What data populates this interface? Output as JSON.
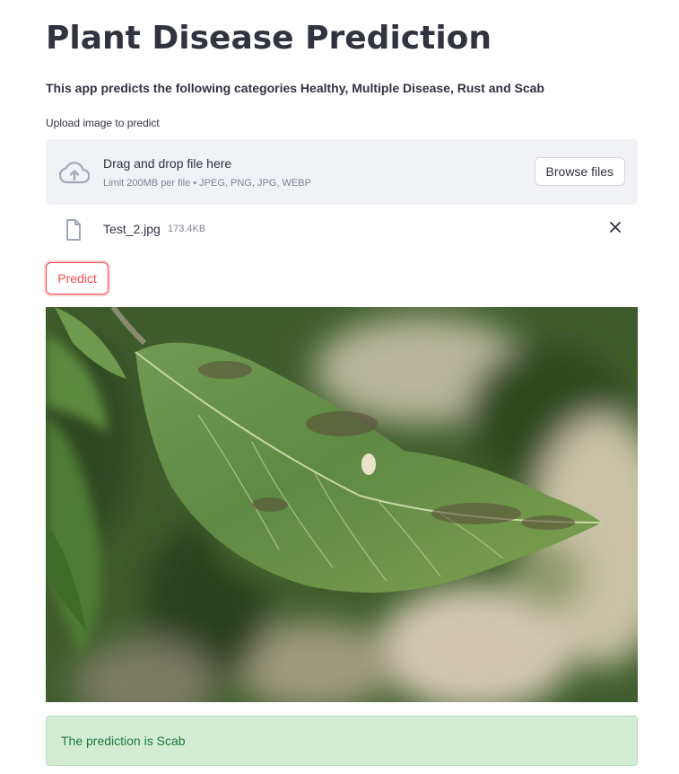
{
  "app": {
    "title": "Plant Disease Prediction",
    "subtitle": "This app predicts the following categories Healthy, Multiple Disease, Rust and Scab"
  },
  "uploader": {
    "label": "Upload image to predict",
    "dropzone_title": "Drag and drop file here",
    "dropzone_limit": "Limit 200MB per file • JPEG, PNG, JPG, WEBP",
    "browse_label": "Browse files",
    "cloud_icon": "cloud-upload-icon"
  },
  "uploaded_file": {
    "name": "Test_2.jpg",
    "size": "173.4KB",
    "file_icon": "file-icon",
    "remove_icon": "close-icon"
  },
  "actions": {
    "predict_label": "Predict"
  },
  "result": {
    "text": "The prediction is Scab"
  },
  "colors": {
    "accent": "#ff4b4b",
    "text": "#31333f",
    "muted": "#808495",
    "dropzone_bg": "#f0f2f6",
    "success_bg": "#d3ecd6",
    "success_text": "#1e7a34"
  }
}
